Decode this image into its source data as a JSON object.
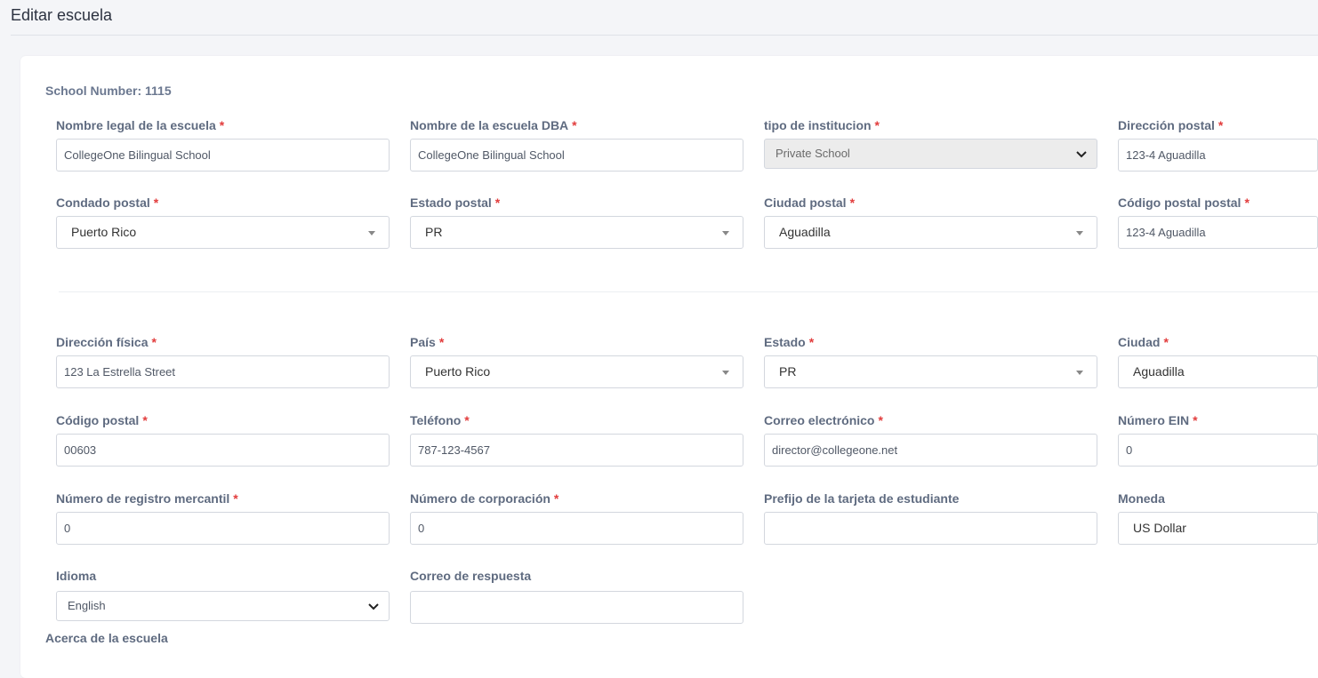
{
  "page": {
    "title": "Editar escuela"
  },
  "school_number": "School Number: 1115",
  "required_mark": "*",
  "fields": {
    "legal_name": {
      "label": "Nombre legal de la escuela",
      "value": "CollegeOne Bilingual School"
    },
    "dba_name": {
      "label": "Nombre de la escuela DBA",
      "value": "CollegeOne Bilingual School"
    },
    "institution_type": {
      "label": "tipo de institucion",
      "value": "Private School"
    },
    "postal_address": {
      "label": "Dirección postal",
      "value": "123-4 Aguadilla"
    },
    "postal_county": {
      "label": "Condado postal",
      "value": "Puerto Rico"
    },
    "postal_state": {
      "label": "Estado postal",
      "value": "PR"
    },
    "postal_city": {
      "label": "Ciudad postal",
      "value": "Aguadilla"
    },
    "postal_zip": {
      "label": "Código postal postal",
      "value": "123-4 Aguadilla"
    },
    "physical_address": {
      "label": "Dirección física",
      "value": "123 La Estrella Street"
    },
    "country": {
      "label": "País",
      "value": "Puerto Rico"
    },
    "state": {
      "label": "Estado",
      "value": "PR"
    },
    "city": {
      "label": "Ciudad",
      "value": "Aguadilla"
    },
    "zip": {
      "label": "Código postal",
      "value": "00603"
    },
    "phone": {
      "label": "Teléfono",
      "value": "787-123-4567"
    },
    "email": {
      "label": "Correo electrónico",
      "value": "director@collegeone.net"
    },
    "ein": {
      "label": "Número EIN",
      "value": "0"
    },
    "merchant_registry": {
      "label": "Número de registro mercantil",
      "value": "0"
    },
    "corporation_number": {
      "label": "Número de corporación",
      "value": "0"
    },
    "student_card_prefix": {
      "label": "Prefijo de la tarjeta de estudiante",
      "value": ""
    },
    "currency": {
      "label": "Moneda",
      "value": "US Dollar"
    },
    "language": {
      "label": "Idioma",
      "value": "English"
    },
    "reply_email": {
      "label": "Correo de respuesta",
      "value": ""
    }
  },
  "about": {
    "label": "Acerca de la escuela"
  }
}
